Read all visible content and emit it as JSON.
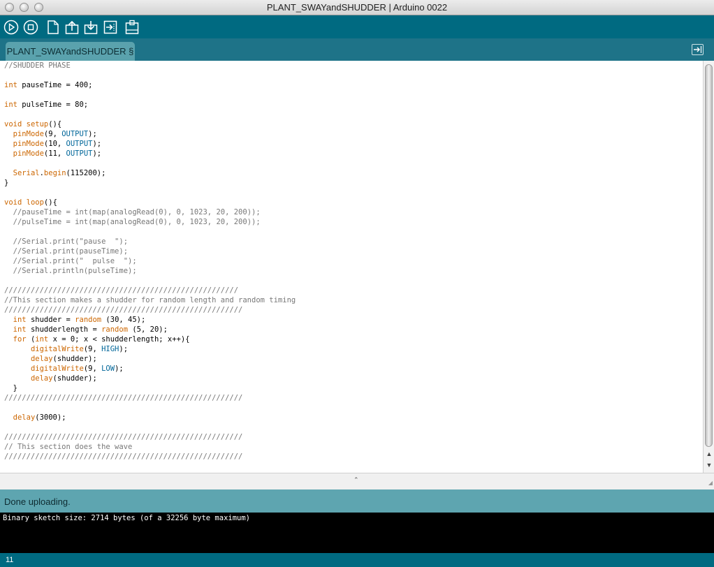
{
  "window": {
    "title": "PLANT_SWAYandSHUDDER | Arduino 0022"
  },
  "toolbar": {
    "buttons": [
      {
        "icon": "verify-play-icon"
      },
      {
        "icon": "stop-icon"
      },
      {
        "icon": "new-file-icon"
      },
      {
        "icon": "open-upload-icon"
      },
      {
        "icon": "save-download-icon"
      },
      {
        "icon": "upload-board-icon"
      },
      {
        "icon": "serial-monitor-icon"
      }
    ]
  },
  "tabs": [
    {
      "label": "PLANT_SWAYandSHUDDER §"
    }
  ],
  "editor": {
    "lines": [
      "//SHUDDER PHASE",
      "",
      "int pauseTime = 400;",
      "",
      "int pulseTime = 80;",
      "",
      "void setup(){",
      "  pinMode(9, OUTPUT);",
      "  pinMode(10, OUTPUT);",
      "  pinMode(11, OUTPUT);",
      "",
      "  Serial.begin(115200);",
      "}",
      "",
      "void loop(){",
      "  //pauseTime = int(map(analogRead(0), 0, 1023, 20, 200));",
      "  //pulseTime = int(map(analogRead(0), 0, 1023, 20, 200));",
      "",
      "  //Serial.print(\"pause  \");",
      "  //Serial.print(pauseTime);",
      "  //Serial.print(\"  pulse  \");",
      "  //Serial.println(pulseTime);",
      "",
      "/////////////////////////////////////////////////////",
      "//This section makes a shudder for random length and random timing",
      "//////////////////////////////////////////////////////",
      "  int shudder = random (30, 45);",
      "  int shudderlength = random (5, 20);",
      "  for (int x = 0; x < shudderlength; x++){",
      "      digitalWrite(9, HIGH);",
      "      delay(shudder);",
      "      digitalWrite(9, LOW);",
      "      delay(shudder);",
      "  }",
      "//////////////////////////////////////////////////////",
      "",
      "  delay(3000);",
      "",
      "//////////////////////////////////////////////////////",
      "// This section does the wave",
      "//////////////////////////////////////////////////////"
    ]
  },
  "status": {
    "message": "Done uploading."
  },
  "console": {
    "output": "Binary sketch size: 2714 bytes (of a 32256 byte maximum)"
  },
  "footer": {
    "line_number": "11"
  },
  "colors": {
    "toolbar": "#006a81",
    "tabbar": "#1e7388",
    "tab": "#5aa2ad",
    "status": "#5ea5b0",
    "console": "#000000",
    "keyword": "#cc6600",
    "constant": "#006699",
    "comment": "#777777"
  }
}
